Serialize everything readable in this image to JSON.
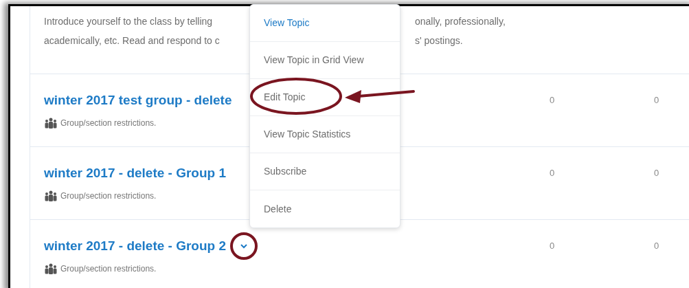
{
  "description": {
    "line_1": [
      "Introduce yourself to the class by telling",
      "onally, professionally,"
    ],
    "line_2": [
      "academically, etc. Read and respond to c",
      "s' postings."
    ]
  },
  "topics": [
    {
      "title": "winter 2017 test group - delete",
      "restriction": "Group/section restrictions.",
      "column_2": "0",
      "column_3": "0",
      "menu_button": false
    },
    {
      "title": "winter 2017 - delete - Group 1",
      "restriction": "Group/section restrictions.",
      "column_2": "0",
      "column_3": "0",
      "menu_button": false
    },
    {
      "title": "winter 2017 - delete - Group 2",
      "restriction": "Group/section restrictions.",
      "column_2": "0",
      "column_3": "0",
      "menu_button": true
    }
  ],
  "context_menu": {
    "items": [
      {
        "label": "View Topic",
        "selected": true
      },
      {
        "label": "View Topic in Grid View",
        "selected": false
      },
      {
        "label": "Edit Topic",
        "selected": false
      },
      {
        "label": "View Topic Statistics",
        "selected": false
      },
      {
        "label": "Subscribe",
        "selected": false
      },
      {
        "label": "Delete",
        "selected": false
      }
    ]
  }
}
